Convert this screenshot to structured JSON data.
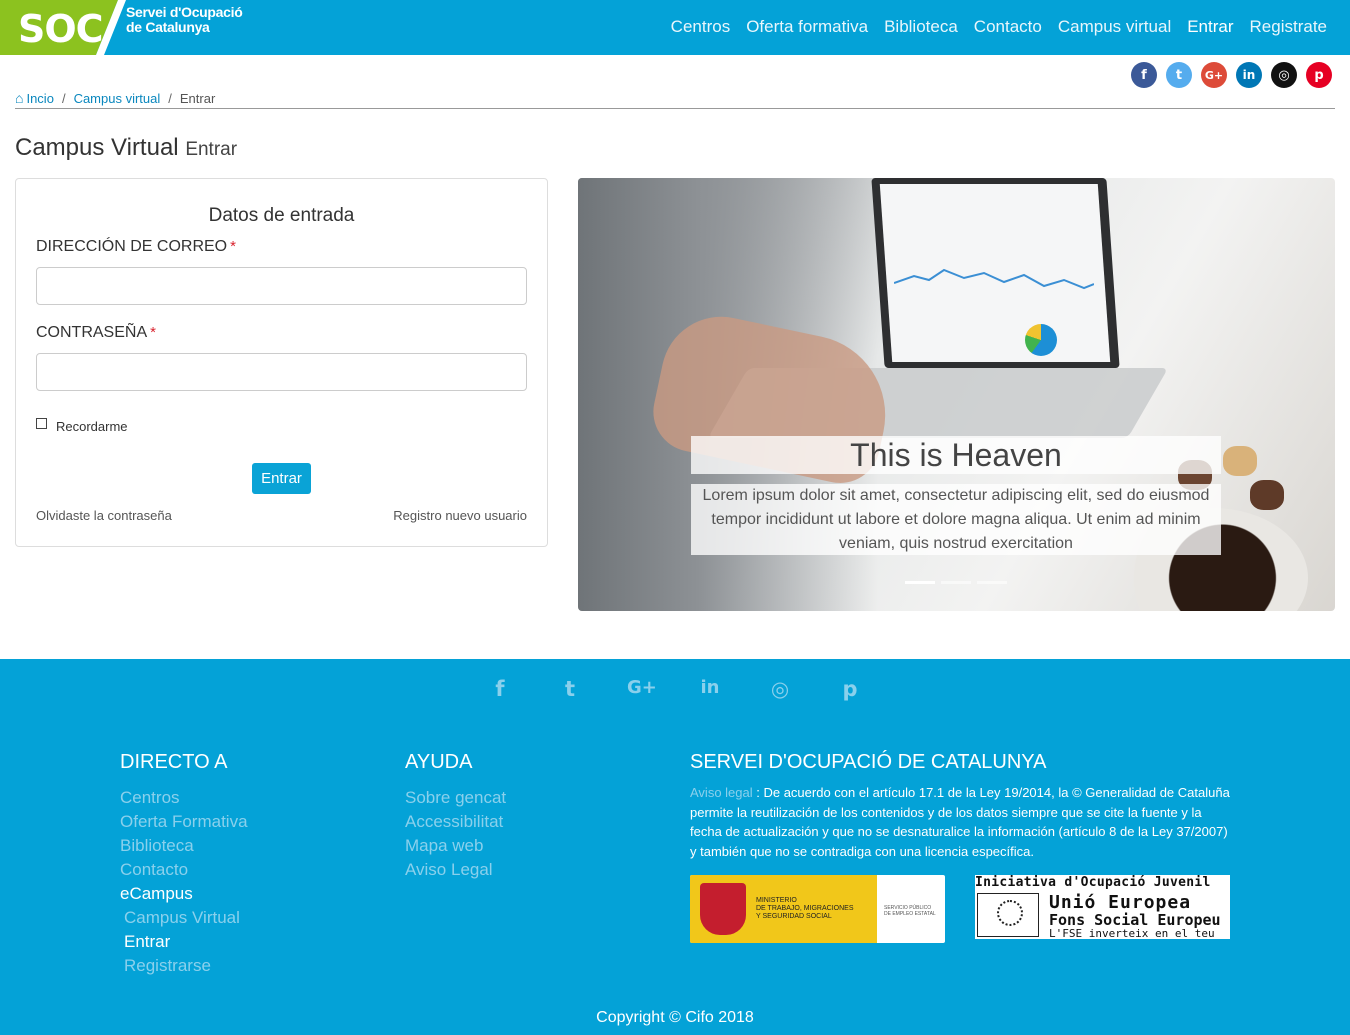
{
  "header": {
    "logo_abbr": "SOC",
    "logo_line1": "Servei d'Ocupació",
    "logo_line2": "de Catalunya",
    "nav": [
      {
        "label": "Centros"
      },
      {
        "label": "Oferta formativa"
      },
      {
        "label": "Biblioteca"
      },
      {
        "label": "Contacto"
      },
      {
        "label": "Campus virtual"
      },
      {
        "label": "Entrar"
      },
      {
        "label": "Registrate"
      }
    ]
  },
  "social_top": [
    {
      "icon": "facebook-icon",
      "glyph": "f",
      "color": "#3b5998"
    },
    {
      "icon": "twitter-icon",
      "glyph": "t",
      "color": "#55acee"
    },
    {
      "icon": "google-plus-icon",
      "glyph": "G+",
      "color": "#dd4b39"
    },
    {
      "icon": "linkedin-icon",
      "glyph": "in",
      "color": "#0077b5"
    },
    {
      "icon": "instagram-icon",
      "glyph": "◎",
      "color": "#111111"
    },
    {
      "icon": "pinterest-icon",
      "glyph": "p",
      "color": "#e60023"
    }
  ],
  "breadcrumb": {
    "home_icon": "⌂",
    "home": "Incio",
    "campus": "Campus virtual",
    "current": "Entrar",
    "separator": "/"
  },
  "page": {
    "title": "Campus Virtual",
    "subtitle": "Entrar"
  },
  "login": {
    "title": "Datos de entrada",
    "email_label": "DIRECCIÓN DE CORREO",
    "email_value": "",
    "password_label": "CONTRASEÑA",
    "password_value": "",
    "required_mark": "*",
    "remember_label": "Recordarme",
    "submit_label": "Entrar",
    "forgot_label": "Olvidaste la contraseña",
    "register_label": "Registro nuevo usuario"
  },
  "carousel": {
    "caption_title": "This is Heaven",
    "caption_text": "Lorem ipsum dolor sit amet, consectetur adipiscing elit, sed do eiusmod tempor incididunt ut labore et dolore magna aliqua. Ut enim ad minim veniam, quis nostrud exercitation",
    "slides": 3,
    "active_slide": 1
  },
  "footer": {
    "social": [
      {
        "icon": "facebook-icon",
        "glyph": "f"
      },
      {
        "icon": "twitter-icon",
        "glyph": "t"
      },
      {
        "icon": "google-plus-icon",
        "glyph": "G+"
      },
      {
        "icon": "linkedin-icon",
        "glyph": "in"
      },
      {
        "icon": "instagram-icon",
        "glyph": "◎"
      },
      {
        "icon": "pinterest-icon",
        "glyph": "p"
      }
    ],
    "col1_title": "DIRECTO A",
    "col1_items": [
      "Centros",
      "Oferta Formativa",
      "Biblioteca",
      "Contacto",
      "eCampus",
      "Campus Virtual",
      "Entrar",
      "Registrarse"
    ],
    "col2_title": "AYUDA",
    "col2_items": [
      "Sobre gencat",
      "Accessibilitat",
      "Mapa web",
      "Aviso Legal"
    ],
    "col3_title": "SERVEI D'OCUPACIÓ DE CATALUNYA",
    "legal_link": "Aviso legal",
    "legal_text": " : De acuerdo con el artículo 17.1 de la Ley 19/2014, la © Generalidad de Cataluña permite la reutilización de los contenidos y de los datos siempre que se cite la fuente y la fecha de actualización y que no se desnaturalice la información (artículo 8 de la Ley 37/2007) y también que no se contradiga con una licencia específica.",
    "ministerio_line1": "MINISTERIO",
    "ministerio_line2": "DE TRABAJO, MIGRACIONES",
    "ministerio_line3": "Y SEGURIDAD SOCIAL",
    "sepe_line1": "SERVICIO PÚBLICO",
    "sepe_line2": "DE EMPLEO ESTATAL",
    "ue_line1": "Iniciativa d'Ocupació Juvenil",
    "ue_line2": "Unió Europea",
    "ue_line3": "Fons Social Europeu",
    "ue_line4": "L'FSE inverteix en el teu futur",
    "copyright": "Copyright © Cifo 2018"
  },
  "colors": {
    "brand_blue": "#04a2d7",
    "brand_green": "#8cc21f",
    "link": "#0a87be",
    "required": "#d9232e"
  }
}
